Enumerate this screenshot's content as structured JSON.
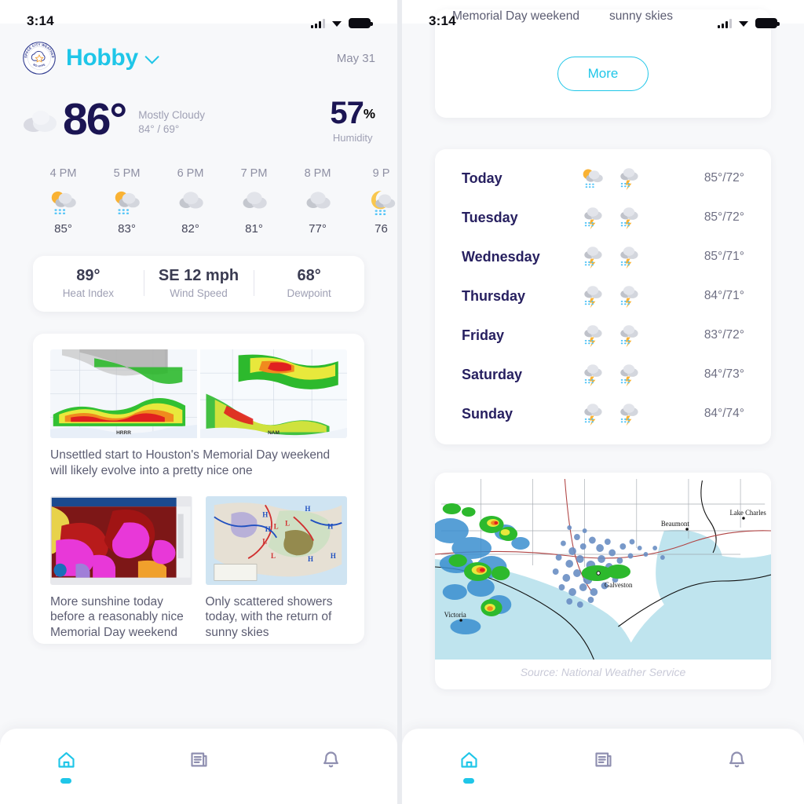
{
  "status_bar": {
    "time": "3:14",
    "signal_icon": "signal-bars-icon",
    "wifi_icon": "wifi-icon",
    "battery_icon": "battery-icon"
  },
  "header": {
    "logo_alt": "space-city-weather-logo",
    "logo_text_top": "SPACE CITY WEATHER",
    "logo_text_bottom": "NO HYPE",
    "location": "Hobby",
    "location_chevron": "chevron-down-icon",
    "date": "May 31"
  },
  "current": {
    "icon": "cloud-icon",
    "temperature": "86°",
    "description": "Mostly Cloudy",
    "high_low": "84° / 69°",
    "humidity_value": "57",
    "humidity_unit": "%",
    "humidity_label": "Humidity"
  },
  "hourly": [
    {
      "time": "4 PM",
      "icon": "sun-cloud-rain-icon",
      "temp": "85°"
    },
    {
      "time": "5 PM",
      "icon": "sun-cloud-rain-icon",
      "temp": "83°"
    },
    {
      "time": "6 PM",
      "icon": "cloud-icon",
      "temp": "82°"
    },
    {
      "time": "7 PM",
      "icon": "cloud-icon",
      "temp": "81°"
    },
    {
      "time": "8 PM",
      "icon": "cloud-icon",
      "temp": "77°"
    },
    {
      "time": "9 P",
      "icon": "moon-cloud-rain-icon",
      "temp": "76"
    }
  ],
  "stats": [
    {
      "value": "89°",
      "label": "Heat Index"
    },
    {
      "value": "SE 12 mph",
      "label": "Wind Speed"
    },
    {
      "value": "68°",
      "label": "Dewpoint"
    }
  ],
  "news": {
    "hero": {
      "left_tag": "HRRR",
      "right_tag": "NAM",
      "title": "Unsettled start to Houston's Memorial Day weekend will likely evolve into a pretty nice one"
    },
    "items": [
      {
        "thumb": "precipitation-map-thumbnail",
        "caption": "More sunshine today before a reasonably nice Memorial Day weekend"
      },
      {
        "thumb": "surface-analysis-map-thumbnail",
        "caption": "Only scattered showers today, with the return of sunny skies"
      }
    ]
  },
  "right_panel": {
    "clipped_headlines": [
      "Memorial Day weekend",
      "sunny skies"
    ],
    "more_button": "More",
    "daily": [
      {
        "day": "Today",
        "icon_day": "sun-cloud-rain-icon",
        "icon_night": "cloud-storm-icon",
        "temps": "85°/72°"
      },
      {
        "day": "Tuesday",
        "icon_day": "cloud-storm-icon",
        "icon_night": "cloud-storm-icon",
        "temps": "85°/72°"
      },
      {
        "day": "Wednesday",
        "icon_day": "cloud-storm-icon",
        "icon_night": "cloud-storm-icon",
        "temps": "85°/71°"
      },
      {
        "day": "Thursday",
        "icon_day": "cloud-storm-icon",
        "icon_night": "cloud-storm-icon",
        "temps": "84°/71°"
      },
      {
        "day": "Friday",
        "icon_day": "cloud-storm-icon",
        "icon_night": "cloud-storm-icon",
        "temps": "83°/72°"
      },
      {
        "day": "Saturday",
        "icon_day": "cloud-storm-icon",
        "icon_night": "cloud-storm-icon",
        "temps": "84°/73°"
      },
      {
        "day": "Sunday",
        "icon_day": "cloud-storm-icon",
        "icon_night": "cloud-storm-icon",
        "temps": "84°/74°"
      }
    ],
    "radar": {
      "alt": "gulf-coast-radar-map",
      "labels": [
        "Victoria",
        "Beaumont",
        "Lake Charles",
        "Galveston"
      ],
      "source": "Source: National Weather Service"
    }
  },
  "nav": [
    {
      "id": "home",
      "icon": "home-icon",
      "active": true
    },
    {
      "id": "news",
      "icon": "news-icon",
      "active": false
    },
    {
      "id": "alerts",
      "icon": "bell-icon",
      "active": false
    }
  ],
  "colors": {
    "accent": "#1fc6e8",
    "navy": "#1b1553",
    "muted": "#9fa0b4",
    "bg": "#f7f8fa"
  }
}
